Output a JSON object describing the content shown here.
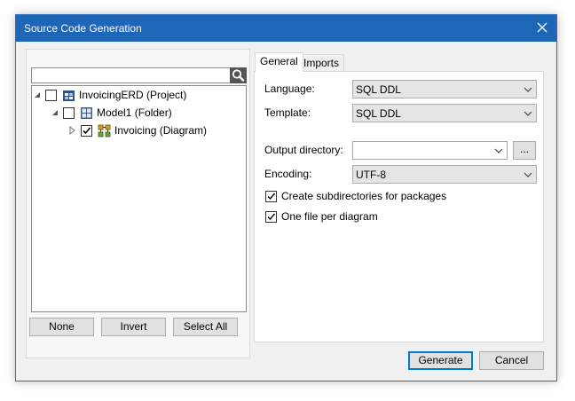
{
  "window": {
    "title": "Source Code Generation"
  },
  "tree": {
    "search": {
      "value": "",
      "placeholder": ""
    },
    "nodes": [
      {
        "label": "InvoicingERD (Project)",
        "checked": false,
        "icon": "project-icon"
      },
      {
        "label": "Model1 (Folder)",
        "checked": false,
        "icon": "folder-model-icon"
      },
      {
        "label": "Invoicing (Diagram)",
        "checked": true,
        "icon": "diagram-icon"
      }
    ]
  },
  "left_buttons": {
    "none": "None",
    "invert": "Invert",
    "select_all": "Select All"
  },
  "tabs": [
    {
      "label": "General",
      "active": true
    },
    {
      "label": "Imports",
      "active": false
    }
  ],
  "general": {
    "language": {
      "label": "Language:",
      "value": "SQL DDL"
    },
    "template": {
      "label": "Template:",
      "value": "SQL DDL"
    },
    "output_directory": {
      "label": "Output directory:",
      "value": "",
      "browse": "..."
    },
    "encoding": {
      "label": "Encoding:",
      "value": "UTF-8"
    },
    "create_subdirs": {
      "label": "Create subdirectories for packages",
      "checked": true
    },
    "one_file": {
      "label": "One file per diagram",
      "checked": true
    }
  },
  "footer": {
    "generate": "Generate",
    "cancel": "Cancel"
  },
  "colors": {
    "titlebar": "#1e66b8",
    "accent": "#0078d7"
  }
}
